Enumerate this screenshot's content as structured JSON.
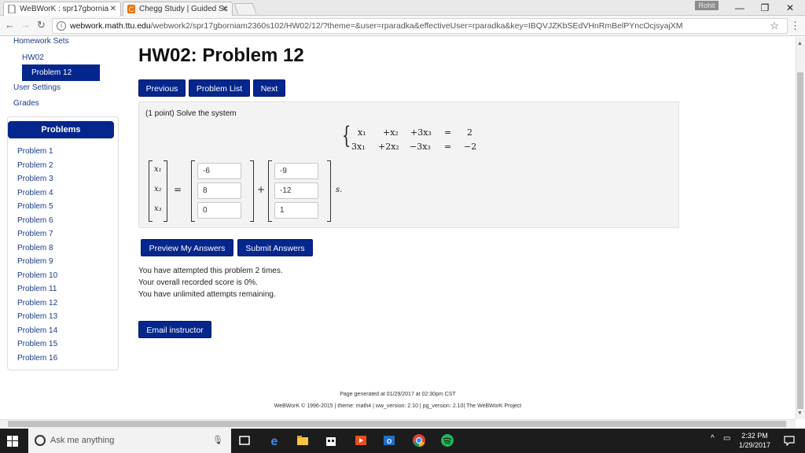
{
  "browser": {
    "tab1_title": "WeBWorK : spr17gbornia",
    "tab2_title": "Chegg Study | Guided Sc",
    "profile_name": "Rohit",
    "url_host": "webwork.math.ttu.edu",
    "url_path": "/webwork2/spr17gborniam2360s102/HW02/12/?theme=&user=rparadka&effectiveUser=rparadka&key=IBQVJZKbSEdVHnRmBelPYncOcjsyajXM",
    "minimize": "—",
    "restore": "❐",
    "close": "✕"
  },
  "sidebar": {
    "homework_sets": "Homework Sets",
    "hw02": "HW02",
    "problem_12": "Problem 12",
    "user_settings": "User Settings",
    "grades": "Grades",
    "problems_header": "Problems",
    "problems": [
      "Problem 1",
      "Problem 2",
      "Problem 3",
      "Problem 4",
      "Problem 5",
      "Problem 6",
      "Problem 7",
      "Problem 8",
      "Problem 9",
      "Problem 10",
      "Problem 11",
      "Problem 12",
      "Problem 13",
      "Problem 14",
      "Problem 15",
      "Problem 16"
    ]
  },
  "main": {
    "title": "HW02: Problem 12",
    "nav": {
      "previous": "Previous",
      "problem_list": "Problem List",
      "next": "Next"
    },
    "prompt": "(1 point) Solve the system",
    "system": {
      "row1": {
        "c1": "x₁",
        "c2": "+x₂",
        "c3": "+3x₃",
        "eq": "=",
        "rhs": "2"
      },
      "row2": {
        "c1": "3x₁",
        "c2": "+2x₂",
        "c3": "−3x₃",
        "eq": "=",
        "rhs": "−2"
      }
    },
    "vars": [
      "x₁",
      "x₂",
      "x₃"
    ],
    "equals": "=",
    "plus": "+",
    "param": "s.",
    "answers_col1": [
      "-6",
      "8",
      "0"
    ],
    "answers_col2": [
      "-9",
      "-12",
      "1"
    ],
    "buttons": {
      "preview": "Preview My Answers",
      "submit": "Submit Answers",
      "email": "Email instructor"
    },
    "status": [
      "You have attempted this problem 2 times.",
      "Your overall recorded score is 0%.",
      "You have unlimited attempts remaining."
    ]
  },
  "footer": {
    "generated": "Page generated at 01/29/2017 at 02:30pm CST",
    "credits": "WeBWorK © 1996-2015 | theme: math4 | ww_version: 2.10 | pg_version: 2.10| The WeBWorK Project"
  },
  "taskbar": {
    "search_placeholder": "Ask me anything",
    "time": "2:32 PM",
    "date": "1/29/2017"
  },
  "colors": {
    "primary": "#05268c",
    "link": "#1a3a8a",
    "panel": "#f3f3f3"
  }
}
